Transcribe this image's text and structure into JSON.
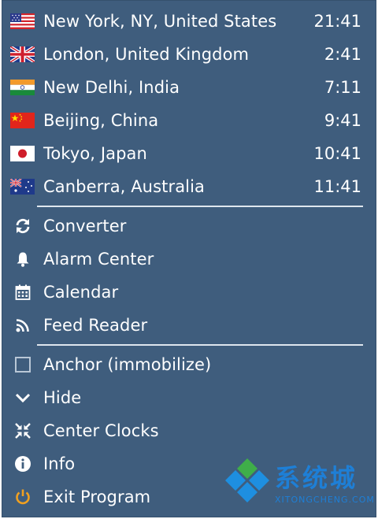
{
  "cities": [
    {
      "label": "New York, NY, United States",
      "time": "21:41",
      "flag": "us-flag-icon"
    },
    {
      "label": "London, United Kingdom",
      "time": "2:41",
      "flag": "uk-flag-icon"
    },
    {
      "label": "New Delhi, India",
      "time": "7:11",
      "flag": "india-flag-icon"
    },
    {
      "label": "Beijing, China",
      "time": "9:41",
      "flag": "china-flag-icon"
    },
    {
      "label": "Tokyo, Japan",
      "time": "10:41",
      "flag": "japan-flag-icon"
    },
    {
      "label": "Canberra, Australia",
      "time": "11:41",
      "flag": "australia-flag-icon"
    }
  ],
  "tools": [
    {
      "label": "Converter",
      "icon": "refresh-icon"
    },
    {
      "label": "Alarm Center",
      "icon": "bell-icon"
    },
    {
      "label": "Calendar",
      "icon": "calendar-icon"
    },
    {
      "label": "Feed Reader",
      "icon": "rss-icon"
    }
  ],
  "options": [
    {
      "label": "Anchor (immobilize)",
      "icon": "checkbox-icon",
      "checked": false
    },
    {
      "label": "Hide",
      "icon": "chevron-down-icon"
    },
    {
      "label": "Center Clocks",
      "icon": "compress-icon"
    },
    {
      "label": "Info",
      "icon": "info-icon"
    },
    {
      "label": "Exit Program",
      "icon": "power-icon"
    }
  ],
  "watermark": {
    "brand": "系统城",
    "domain": "XITONGCHENG.COM"
  },
  "colors": {
    "menu_bg": "#3f5d7d",
    "text": "#ffffff",
    "separator": "#dfe6ee",
    "power_icon": "#f0a020",
    "watermark": "#1e7fd6"
  }
}
